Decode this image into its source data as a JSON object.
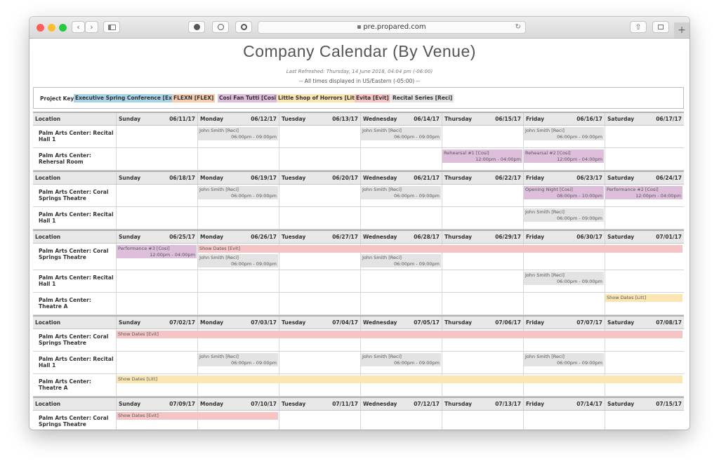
{
  "browser": {
    "address": "pre.propared.com",
    "lock_icon": "lock-icon",
    "colors": {
      "close": "#fe5f57",
      "minimize": "#febc2e",
      "maximize": "#28c840"
    }
  },
  "page": {
    "title": "Company Calendar (By Venue)",
    "refreshed": "Last Refreshed: Thursday, 14 June 2018, 04:04 pm (-06:00)",
    "timezone": "-- All times displayed in US/Eastern (-05:00) --"
  },
  "key": {
    "label": "Project Key",
    "items": [
      {
        "label": "Executive Spring Conference [Exec]",
        "color": "#a9d3e6"
      },
      {
        "label": "FLEXN [FLEX]",
        "color": "#f6cdb1"
      },
      {
        "label": "Cosi Fan Tutti [Cosi]",
        "color": "#ddbfdc"
      },
      {
        "label": "Little Shop of Horrors [Litt]",
        "color": "#fbe6b3"
      },
      {
        "label": "Evita [Evit]",
        "color": "#f5c4c4"
      },
      {
        "label": "Recital Series [Reci]",
        "color": "#e3e3e3"
      }
    ]
  },
  "calendar": {
    "location_header": "Location",
    "day_names": [
      "Sunday",
      "Monday",
      "Tuesday",
      "Wednesday",
      "Thursday",
      "Friday",
      "Saturday"
    ],
    "weeks": [
      {
        "dates": [
          "06/11/17",
          "06/12/17",
          "06/13/17",
          "06/14/17",
          "06/15/17",
          "06/16/17",
          "06/17/17"
        ],
        "rows": [
          {
            "location": "Palm Arts Center: Recital Hall 1",
            "events": [
              {
                "day": 1,
                "span": 1,
                "title": "John Smith [Reci]",
                "time": "06:00pm - 09:00pm",
                "cls": "reci"
              },
              {
                "day": 3,
                "span": 1,
                "title": "John Smith [Reci]",
                "time": "06:00pm - 09:00pm",
                "cls": "reci"
              },
              {
                "day": 5,
                "span": 1,
                "title": "John Smith [Reci]",
                "time": "06:00pm - 09:00pm",
                "cls": "reci"
              }
            ]
          },
          {
            "location": "Palm Arts Center: Rehersal Room",
            "events": [
              {
                "day": 4,
                "span": 1,
                "title": "Rehearsal #1 [Cosi]",
                "time": "12:00pm - 04:00pm",
                "cls": "cosi"
              },
              {
                "day": 5,
                "span": 1,
                "title": "Rehearsal #2 [Cosi]",
                "time": "12:00pm - 04:00pm",
                "cls": "cosi"
              }
            ]
          }
        ]
      },
      {
        "dates": [
          "06/18/17",
          "06/19/17",
          "06/20/17",
          "06/21/17",
          "06/22/17",
          "06/23/17",
          "06/24/17"
        ],
        "rows": [
          {
            "location": "Palm Arts Center: Coral Springs Theatre",
            "events": [
              {
                "day": 1,
                "span": 1,
                "title": "John Smith [Reci]",
                "time": "06:00pm - 09:00pm",
                "cls": "reci"
              },
              {
                "day": 3,
                "span": 1,
                "title": "John Smith [Reci]",
                "time": "06:00pm - 09:00pm",
                "cls": "reci"
              },
              {
                "day": 5,
                "span": 1,
                "title": "Opening Night [Cosi]",
                "time": "08:00pm - 10:00pm",
                "cls": "cosi"
              },
              {
                "day": 6,
                "span": 1,
                "title": "Performance #2 [Cosi]",
                "time": "12:00pm - 04:00pm",
                "cls": "cosi"
              }
            ]
          },
          {
            "location": "Palm Arts Center: Recital Hall 1",
            "events": [
              {
                "day": 5,
                "span": 1,
                "title": "John Smith [Reci]",
                "time": "06:00pm - 09:00pm",
                "cls": "reci"
              }
            ]
          }
        ]
      },
      {
        "dates": [
          "06/25/17",
          "06/26/17",
          "06/27/17",
          "06/28/17",
          "06/29/17",
          "06/30/17",
          "07/01/17"
        ],
        "rows": [
          {
            "location": "Palm Arts Center: Coral Springs Theatre",
            "events": [
              {
                "day": 0,
                "span": 1,
                "title": "Performance #3 [Cosi]",
                "time": "12:00pm - 04:00pm",
                "cls": "cosi"
              },
              {
                "day": 1,
                "span": 6,
                "title": "Show Dates [Evit]",
                "time": "",
                "cls": "evit"
              },
              {
                "day": 1,
                "span": 1,
                "lane": 1,
                "title": "John Smith [Reci]",
                "time": "06:00pm - 09:00pm",
                "cls": "reci"
              },
              {
                "day": 3,
                "span": 1,
                "lane": 1,
                "title": "John Smith [Reci]",
                "time": "06:00pm - 09:00pm",
                "cls": "reci"
              }
            ]
          },
          {
            "location": "Palm Arts Center: Recital Hall 1",
            "events": [
              {
                "day": 5,
                "span": 1,
                "title": "John Smith [Reci]",
                "time": "06:00pm - 09:00pm",
                "cls": "reci"
              }
            ]
          },
          {
            "location": "Palm Arts Center: Theatre A",
            "events": [
              {
                "day": 6,
                "span": 1,
                "title": "Show Dates [Litt]",
                "time": "",
                "cls": "litt"
              }
            ]
          }
        ]
      },
      {
        "dates": [
          "07/02/17",
          "07/03/17",
          "07/04/17",
          "07/05/17",
          "07/06/17",
          "07/07/17",
          "07/08/17"
        ],
        "rows": [
          {
            "location": "Palm Arts Center: Coral Springs Theatre",
            "events": [
              {
                "day": 0,
                "span": 7,
                "title": "Show Dates [Evit]",
                "time": "",
                "cls": "evit"
              }
            ]
          },
          {
            "location": "Palm Arts Center: Recital Hall 1",
            "events": [
              {
                "day": 1,
                "span": 1,
                "title": "John Smith [Reci]",
                "time": "06:00pm - 09:00pm",
                "cls": "reci"
              },
              {
                "day": 3,
                "span": 1,
                "title": "John Smith [Reci]",
                "time": "06:00pm - 09:00pm",
                "cls": "reci"
              },
              {
                "day": 5,
                "span": 1,
                "title": "John Smith [Reci]",
                "time": "06:00pm - 09:00pm",
                "cls": "reci"
              }
            ]
          },
          {
            "location": "Palm Arts Center: Theatre A",
            "events": [
              {
                "day": 0,
                "span": 7,
                "title": "Show Dates [Litt]",
                "time": "",
                "cls": "litt"
              }
            ]
          }
        ]
      },
      {
        "dates": [
          "07/09/17",
          "07/10/17",
          "07/11/17",
          "07/12/17",
          "07/13/17",
          "07/14/17",
          "07/15/17"
        ],
        "rows": [
          {
            "location": "Palm Arts Center: Coral Springs Theatre",
            "events": [
              {
                "day": 0,
                "span": 2,
                "title": "Show Dates [Evit]",
                "time": "",
                "cls": "evit"
              }
            ]
          }
        ]
      }
    ]
  }
}
